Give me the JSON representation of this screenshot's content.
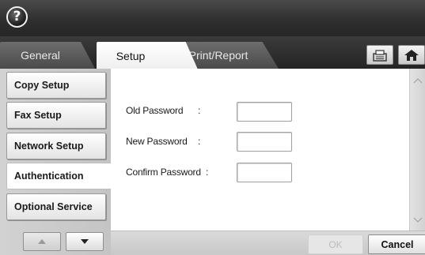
{
  "header": {
    "help_label": "?"
  },
  "tabs": [
    {
      "label": "General",
      "active": false
    },
    {
      "label": "Setup",
      "active": true
    },
    {
      "label": "Print/Report",
      "active": false
    }
  ],
  "toolbar_icons": [
    "machine-status-icon",
    "home-icon"
  ],
  "sidebar": {
    "items": [
      {
        "label": "Copy Setup",
        "active": false
      },
      {
        "label": "Fax Setup",
        "active": false
      },
      {
        "label": "Network Setup",
        "active": false
      },
      {
        "label": "Authentication",
        "active": true
      },
      {
        "label": "Optional Service",
        "active": false
      }
    ],
    "scroll_icons": [
      "triangle-up-icon",
      "triangle-down-icon"
    ]
  },
  "form": {
    "fields": [
      {
        "label": "Old Password",
        "colon": ":",
        "value": ""
      },
      {
        "label": "New Password",
        "colon": ":",
        "value": ""
      },
      {
        "label": "Confirm Password",
        "colon": ":",
        "value": ""
      }
    ]
  },
  "footer": {
    "ok_label": "OK",
    "ok_enabled": false,
    "cancel_label": "Cancel"
  },
  "colors": {
    "header_dark": "#2f2f2f",
    "panel_bg": "#ffffff",
    "sidebar_bg": "#c8c8c8",
    "disabled_text": "#bcbcbd"
  }
}
